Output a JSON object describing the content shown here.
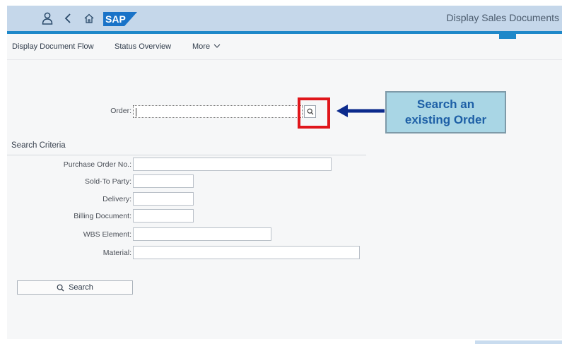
{
  "shell": {
    "title": "Display Sales Documents",
    "icons": [
      "user-icon",
      "back-icon",
      "home-icon"
    ],
    "logo_text": "SAP",
    "colors": {
      "bar": "#c5d7ea",
      "accent": "#1e88c9",
      "logo": "#1a73c8"
    }
  },
  "toolbar": {
    "items": [
      "Display Document Flow",
      "Status Overview"
    ],
    "more_label": "More"
  },
  "form": {
    "order_label": "Order:",
    "order_value": ""
  },
  "search_criteria": {
    "title": "Search Criteria",
    "fields": {
      "purchase_order_no": "Purchase Order No.:",
      "sold_to_party": "Sold-To Party:",
      "delivery": "Delivery:",
      "billing_document": "Billing Document:",
      "wbs_element": "WBS Element:",
      "material": "Material:"
    }
  },
  "search_button": {
    "label": "Search"
  },
  "annotation": {
    "line1": "Search an",
    "line2": "existing Order",
    "colors": {
      "highlight": "#e0161b",
      "arrow": "#0b2a8c",
      "callout_bg": "#a9d6e5",
      "callout_text": "#1d5fa6"
    }
  }
}
